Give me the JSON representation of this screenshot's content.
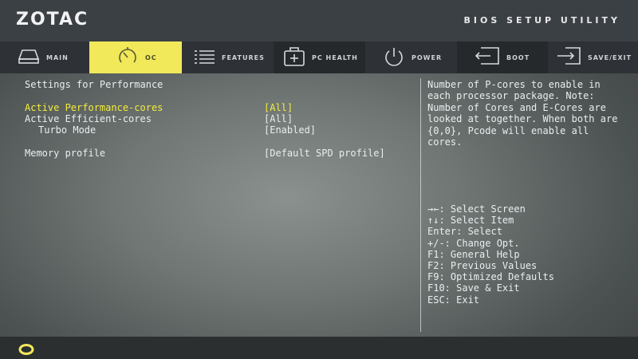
{
  "header": {
    "logo": "ZOTAC",
    "utility_title": "BIOS SETUP UTILITY"
  },
  "tabs": [
    {
      "label": "MAIN",
      "icon": "drive-icon"
    },
    {
      "label": "OC",
      "icon": "speedometer-icon",
      "active": true
    },
    {
      "label": "FEATURES",
      "icon": "list-icon"
    },
    {
      "label": "PC HEALTH",
      "icon": "health-plus-icon"
    },
    {
      "label": "POWER",
      "icon": "power-icon"
    },
    {
      "label": "BOOT",
      "icon": "boot-icon"
    },
    {
      "label": "SAVE/EXIT",
      "icon": "exit-icon"
    }
  ],
  "section_title": "Settings for Performance",
  "settings": [
    {
      "name": "Active Performance-cores",
      "value": "[All]",
      "selected": true
    },
    {
      "name": "Active Efficient-cores",
      "value": "[All]"
    },
    {
      "name": "Turbo Mode",
      "value": "[Enabled]"
    },
    {
      "name": "Memory profile",
      "value": "[Default SPD profile]"
    }
  ],
  "help_text": "Number of P-cores to enable in each processor package. Note: Number of Cores and E-Cores are looked at together. When both are {0,0}, Pcode will enable all cores.",
  "key_help": [
    "→←: Select Screen",
    "↑↓: Select Item",
    "Enter: Select",
    "+/-: Change Opt.",
    "F1: General Help",
    "F2: Previous Values",
    "F9: Optimized Defaults",
    "F10: Save & Exit",
    "ESC: Exit"
  ],
  "colors": {
    "accent": "#f1e85a",
    "highlight_text": "#f4ec3a",
    "text": "#e9eeef"
  }
}
